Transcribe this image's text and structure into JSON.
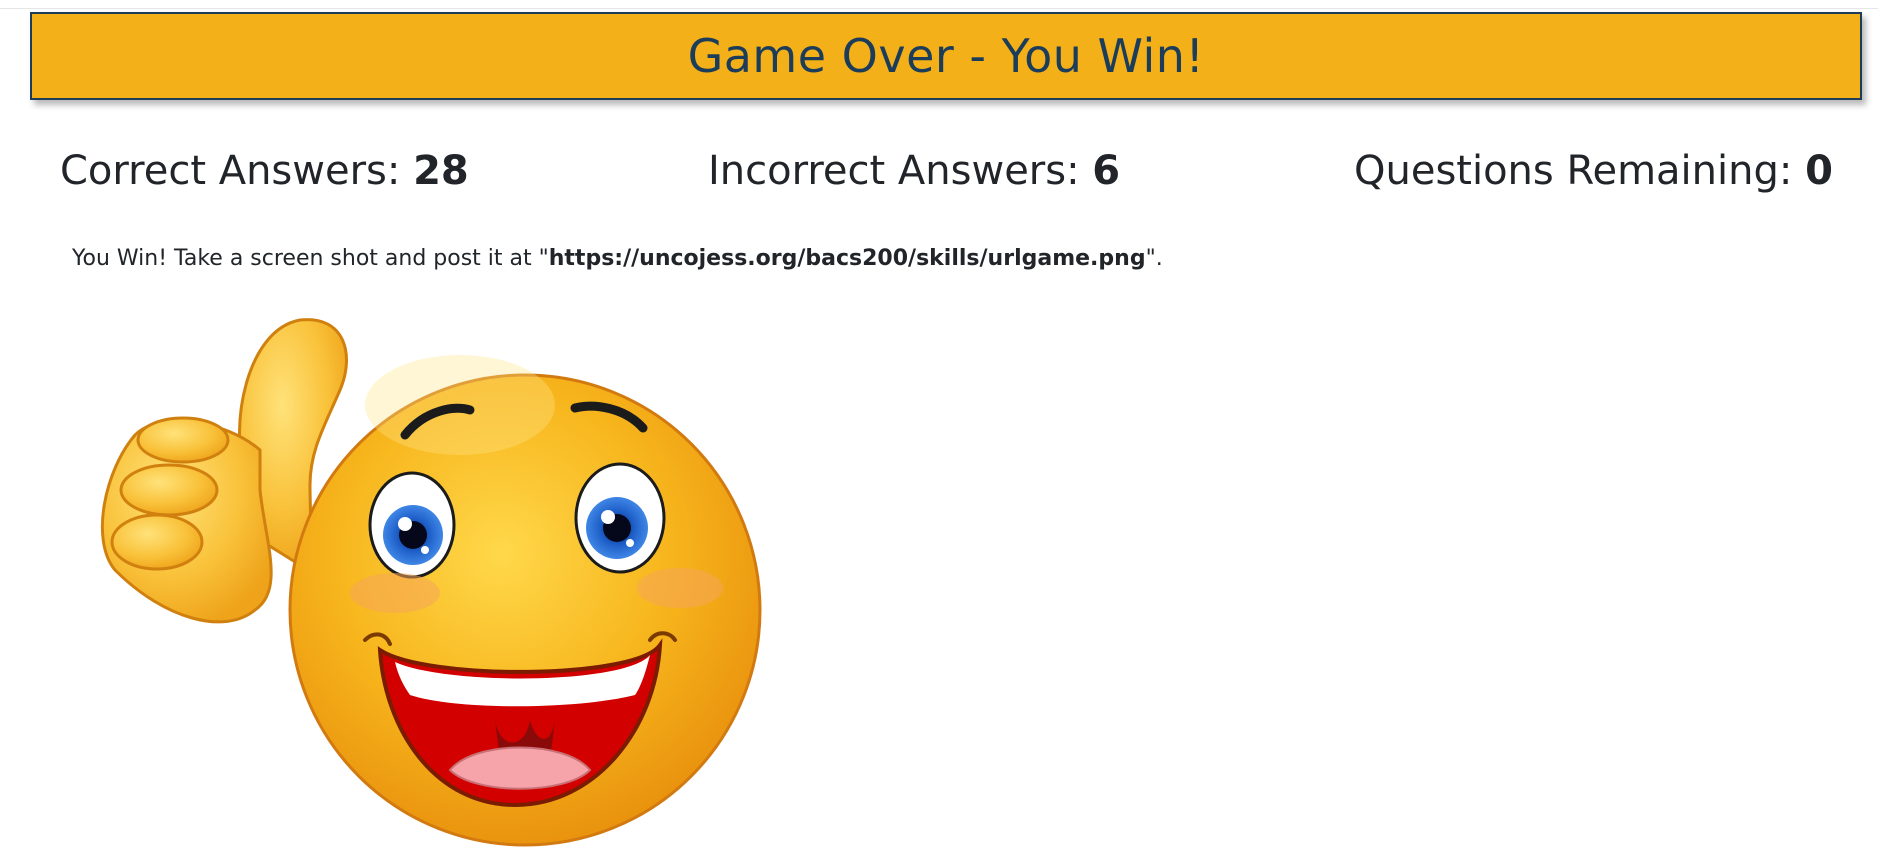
{
  "banner": {
    "title": "Game Over - You Win!"
  },
  "stats": {
    "correct_label": "Correct Answers:",
    "correct_value": "28",
    "incorrect_label": "Incorrect Answers:",
    "incorrect_value": "6",
    "remaining_label": "Questions Remaining:",
    "remaining_value": "0"
  },
  "message": {
    "prefix": "You Win! Take a screen shot and post it at \"",
    "url": "https://uncojess.org/bacs200/skills/urlgame.png",
    "suffix": "\"."
  },
  "image": {
    "icon": "thumbs-up-smiley-icon"
  },
  "colors": {
    "banner_bg": "#f4b019",
    "banner_text": "#1c3d5a",
    "text": "#212529"
  }
}
